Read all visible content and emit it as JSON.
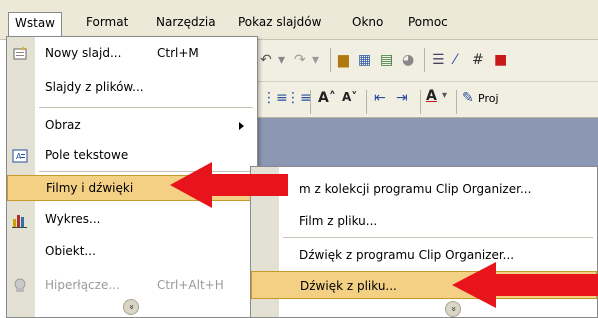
{
  "menubar": {
    "items": [
      {
        "label": "Wstaw"
      },
      {
        "label": "Format"
      },
      {
        "label": "Narzędzia"
      },
      {
        "label": "Pokaz slajdów"
      },
      {
        "label": "Okno"
      },
      {
        "label": "Pomoc"
      }
    ]
  },
  "toolbar": {
    "projector_label": "Proj"
  },
  "insert_menu": {
    "items": [
      {
        "label": "Nowy slajd...",
        "shortcut": "Ctrl+M",
        "icon": "new-slide-icon",
        "enabled": true
      },
      {
        "label": "Slajdy z plików...",
        "icon": "",
        "enabled": true
      },
      {
        "label": "Obraz",
        "icon": "",
        "enabled": true,
        "submenu": true
      },
      {
        "label": "Pole tekstowe",
        "icon": "text-box-icon",
        "enabled": true
      },
      {
        "label": "Filmy i dźwięki",
        "icon": "",
        "enabled": true,
        "highlighted": true,
        "submenu": true
      },
      {
        "label": "Wykres...",
        "icon": "chart-icon",
        "enabled": true
      },
      {
        "label": "Obiekt...",
        "icon": "",
        "enabled": true
      },
      {
        "label": "Hiperłącze...",
        "shortcut": "Ctrl+Alt+H",
        "icon": "hyperlink-icon",
        "enabled": false
      }
    ],
    "expand_glyph": "»"
  },
  "media_submenu": {
    "items": [
      {
        "label": "Film z kolekcji programu Clip Organizer...",
        "visible_label": "m z kolekcji programu Clip Organizer..."
      },
      {
        "label": "Film z pliku..."
      },
      {
        "label": "Dźwięk z programu Clip Organizer..."
      },
      {
        "label": "Dźwięk z pliku...",
        "highlighted": true
      }
    ],
    "expand_glyph": "»"
  },
  "colors": {
    "menu_highlight": "#f3d083",
    "annotation_arrow": "#e8141c",
    "menu_strip": "#e3e1d4"
  }
}
